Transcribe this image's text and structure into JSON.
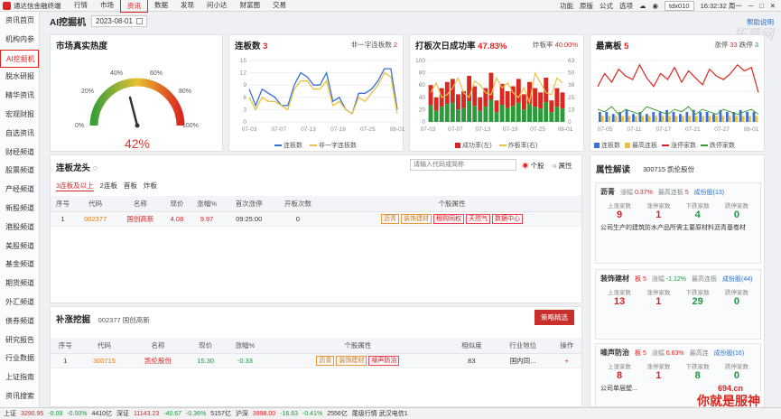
{
  "titlebar": {
    "app_name": "通达信金融终端",
    "menu": [
      "行情",
      "市场",
      "资讯",
      "数据",
      "发现",
      "问小达",
      "财富圈",
      "交易"
    ],
    "active_menu": "资讯",
    "right_items": [
      "功能",
      "原版",
      "公式",
      "选项"
    ],
    "account": "tdx010",
    "time": "16:32:32 周一"
  },
  "sidebar": {
    "items": [
      "资讯首页",
      "机构内参",
      "AI挖掘机",
      "脱水研报",
      "精华资讯",
      "宏观财报",
      "自选资讯",
      "财经频道",
      "股票频道",
      "产经频道",
      "新股频道",
      "港股频道",
      "美股频道",
      "基金频道",
      "期货频道",
      "外汇频道",
      "债券频道",
      "研究报告",
      "行业数据",
      "上证指南",
      "资讯搜索"
    ],
    "active": "AI挖掘机"
  },
  "header": {
    "title": "AI挖掘机",
    "date": "2023-08-01",
    "help_link": "帮助说明"
  },
  "heat": {
    "title": "市场真实热度",
    "value": "42%",
    "value_fraction": 0.42,
    "ticks": [
      "0%",
      "20%",
      "40%",
      "60%",
      "80%",
      "100%"
    ]
  },
  "limitup": {
    "title": "连板数",
    "count": "3",
    "sub_label": "非一字连板数",
    "sub_count": "2",
    "legend": [
      "连板数",
      "非一字连板数"
    ],
    "colors": [
      "#3a6fd6",
      "#e8c240"
    ]
  },
  "success": {
    "title": "打板次日成功率",
    "rate": "47.83%",
    "sub_label": "炸板率",
    "sub_rate": "40.00%",
    "legend": [
      "成功率(左)",
      "炸板率(右)"
    ]
  },
  "highest": {
    "title": "最高板",
    "count": "5",
    "zt_label": "涨停",
    "zt_count": "33",
    "dt_label": "跌停",
    "dt_count": "3",
    "legend": [
      "连板数",
      "最高连板",
      "涨停家数",
      "跌停家数"
    ]
  },
  "chart_data": [
    {
      "type": "line",
      "title": "连板数",
      "x": [
        "07-03",
        "07-07",
        "07-13",
        "07-19",
        "07-25",
        "08-01"
      ],
      "ylim": [
        0,
        15
      ],
      "yticks": [
        "15",
        "12",
        "9",
        "6",
        "3",
        "0"
      ],
      "series": [
        {
          "name": "连板数",
          "values": [
            8,
            4,
            8,
            7,
            6,
            4,
            4,
            9,
            12,
            11,
            9,
            9,
            12,
            5,
            6,
            3,
            2,
            7,
            7,
            8,
            10,
            13,
            13,
            3
          ]
        },
        {
          "name": "非一字连板数",
          "values": [
            6,
            3,
            6,
            5,
            5,
            4,
            3,
            8,
            10,
            10,
            8,
            8,
            10,
            4,
            5,
            3,
            2,
            6,
            5,
            7,
            9,
            12,
            11,
            2
          ]
        }
      ]
    },
    {
      "type": "bar",
      "title": "打板次日成功率",
      "x": [
        "07-03",
        "07-07",
        "07-13",
        "07-19",
        "07-25",
        "08-01"
      ],
      "ylim": [
        0,
        100
      ],
      "yticks_left": [
        "100",
        "80",
        "60",
        "40",
        "20",
        "0"
      ],
      "yticks_right": [
        "63",
        "50",
        "38",
        "25",
        "13",
        "0"
      ],
      "series": [
        {
          "name": "成功率(左)",
          "values": [
            60,
            40,
            55,
            65,
            70,
            45,
            50,
            75,
            58,
            40,
            55,
            80,
            35,
            62,
            50,
            58,
            70,
            45,
            65,
            55,
            48,
            72,
            35,
            55,
            48
          ]
        },
        {
          "name": "炸板率(右)",
          "values": [
            30,
            40,
            25,
            28,
            35,
            45,
            30,
            25,
            42,
            38,
            30,
            28,
            45,
            35,
            40,
            30,
            25,
            35,
            20,
            50,
            40,
            30,
            28,
            45,
            40
          ]
        }
      ]
    },
    {
      "type": "line",
      "title": "最高板",
      "x": [
        "07-05",
        "07-11",
        "07-17",
        "07-21",
        "07-27",
        "08-01"
      ],
      "series": [
        {
          "name": "连板数",
          "values": [
            5,
            5,
            4,
            5,
            6,
            4,
            5,
            4,
            5,
            5,
            6,
            5,
            4,
            5,
            6,
            5,
            5,
            4,
            6,
            5,
            5,
            6,
            5,
            5
          ]
        },
        {
          "name": "最高连板",
          "values": [
            3,
            3,
            3,
            3,
            3,
            3,
            3,
            3,
            3,
            3,
            3,
            3,
            3,
            3,
            3,
            3,
            3,
            3,
            3,
            3,
            3,
            3,
            3,
            3
          ]
        },
        {
          "name": "涨停家数",
          "values": [
            40,
            55,
            45,
            60,
            52,
            48,
            65,
            50,
            40,
            55,
            48,
            62,
            45,
            58,
            50,
            42,
            60,
            52,
            48,
            55,
            65,
            58,
            62,
            33
          ]
        },
        {
          "name": "跌停家数",
          "values": [
            5,
            4,
            6,
            3,
            5,
            4,
            3,
            6,
            5,
            4,
            3,
            5,
            4,
            6,
            3,
            5,
            4,
            3,
            5,
            4,
            3,
            4,
            5,
            3
          ]
        }
      ]
    }
  ],
  "lianban": {
    "title": "连板龙头",
    "search_placeholder": "请输入代码或简称",
    "radio_stock": "个股",
    "radio_attr": "属性",
    "tabs": [
      "3连板及以上",
      "2连板",
      "首板",
      "炸板"
    ],
    "columns": [
      "序号",
      "代码",
      "名称",
      "现价",
      "涨幅%",
      "首次涨停",
      "开板次数",
      "个股属性"
    ],
    "rows": [
      {
        "idx": "1",
        "code": "002377",
        "name": "国创高新",
        "price": "4.08",
        "chg": "9.97",
        "first": "09:25:00",
        "open": "0",
        "tags": [
          "沥青",
          "装饰建材",
          "租购同权",
          "天然气",
          "数据中心"
        ]
      }
    ]
  },
  "buzhang": {
    "title": "补涨挖掘",
    "ref": "002377 国创高新",
    "button": "策略精选",
    "columns": [
      "序号",
      "代码",
      "名称",
      "现价",
      "涨幅%",
      "个股属性",
      "相似度",
      "行业地位",
      "操作"
    ],
    "rows": [
      {
        "idx": "1",
        "code": "300715",
        "name": "凯伦股份",
        "price": "15.30",
        "chg": "-0.33",
        "tags": [
          "沥青",
          "装饰建材",
          "噪声防治"
        ],
        "sim": "83",
        "pos": "国内同...",
        "op": "+"
      }
    ]
  },
  "attr_panel": {
    "title": "属性解读",
    "stock": "300715 凯伦股份",
    "blocks": [
      {
        "name": "沥青",
        "chg_label": "涨幅",
        "chg": "0.37%",
        "top_label": "最高连板",
        "top": "5",
        "link": "成份股(13)",
        "stats": [
          [
            "上涨家数",
            "9"
          ],
          [
            "涨停家数",
            "1"
          ],
          [
            "下跌家数",
            "4"
          ],
          [
            "跌停家数",
            "0"
          ]
        ],
        "desc": "公司生产的建筑防水产品所需主要原材料沥青基卷材"
      },
      {
        "name": "装饰建材",
        "extra": "板 5",
        "chg_label": "涨幅",
        "chg": "-1.12%",
        "top_label": "最高连板",
        "top": "",
        "link": "成份股(44)",
        "stats": [
          [
            "上涨家数",
            "13"
          ],
          [
            "涨停家数",
            "1"
          ],
          [
            "下跌家数",
            "29"
          ],
          [
            "跌停家数",
            "0"
          ]
        ],
        "desc": ""
      },
      {
        "name": "噪声防治",
        "extra": "板 5",
        "chg_label": "涨幅",
        "chg": "0.63%",
        "top_label": "最高连",
        "top": "",
        "link": "成份股(16)",
        "stats": [
          [
            "上涨家数",
            "8"
          ],
          [
            "涨停家数",
            "1"
          ],
          [
            "下跌家数",
            "8"
          ],
          [
            "跌停家数",
            "0"
          ]
        ],
        "desc": "公司单层塑..."
      }
    ]
  },
  "statusbar": {
    "items": [
      "上证",
      "3290.95",
      "-0.09",
      "-0.00%",
      "4410亿",
      "深证",
      "11143.23",
      "-40.67",
      "-0.36%",
      "5157亿",
      "沪深",
      "3998.00",
      "-16.63",
      "-0.41%",
      "2556亿",
      "尾级行情 武汉电信1"
    ]
  },
  "watermarks": {
    "top": "拓荒网",
    "bottom": "你就是服神",
    "domain": "694.cn"
  }
}
